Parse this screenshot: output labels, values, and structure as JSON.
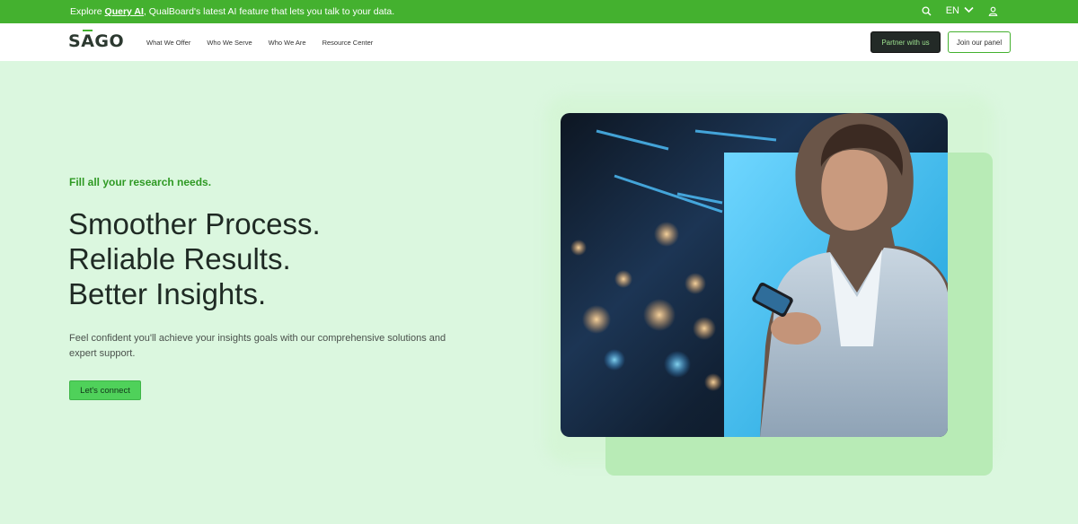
{
  "topbar": {
    "announce_prefix": "Explore ",
    "announce_link": "Query AI",
    "announce_suffix": ", QualBoard's latest AI feature that lets you talk to your data.",
    "language": "EN",
    "search_icon": "search-icon",
    "user_icon": "user-icon"
  },
  "nav": {
    "logo": "SAGO",
    "logo_first": "S",
    "logo_macron": "A",
    "logo_rest": "GO",
    "links": [
      "What We Offer",
      "Who We Serve",
      "Who We Are",
      "Resource Center"
    ],
    "partner_label": "Partner with us",
    "panel_label": "Join our panel"
  },
  "hero": {
    "eyebrow": "Fill all your research needs.",
    "headline": [
      "Smoother Process.",
      "Reliable Results.",
      "Better Insights."
    ],
    "description": "Feel confident you'll achieve your insights goals with our comprehensive solutions and expert support.",
    "cta_label": "Let's connect"
  },
  "colors": {
    "brand_green": "#44b12f",
    "cta_green": "#4fd15a",
    "hero_bg": "#dbf7df",
    "dark_button": "#232a27"
  }
}
